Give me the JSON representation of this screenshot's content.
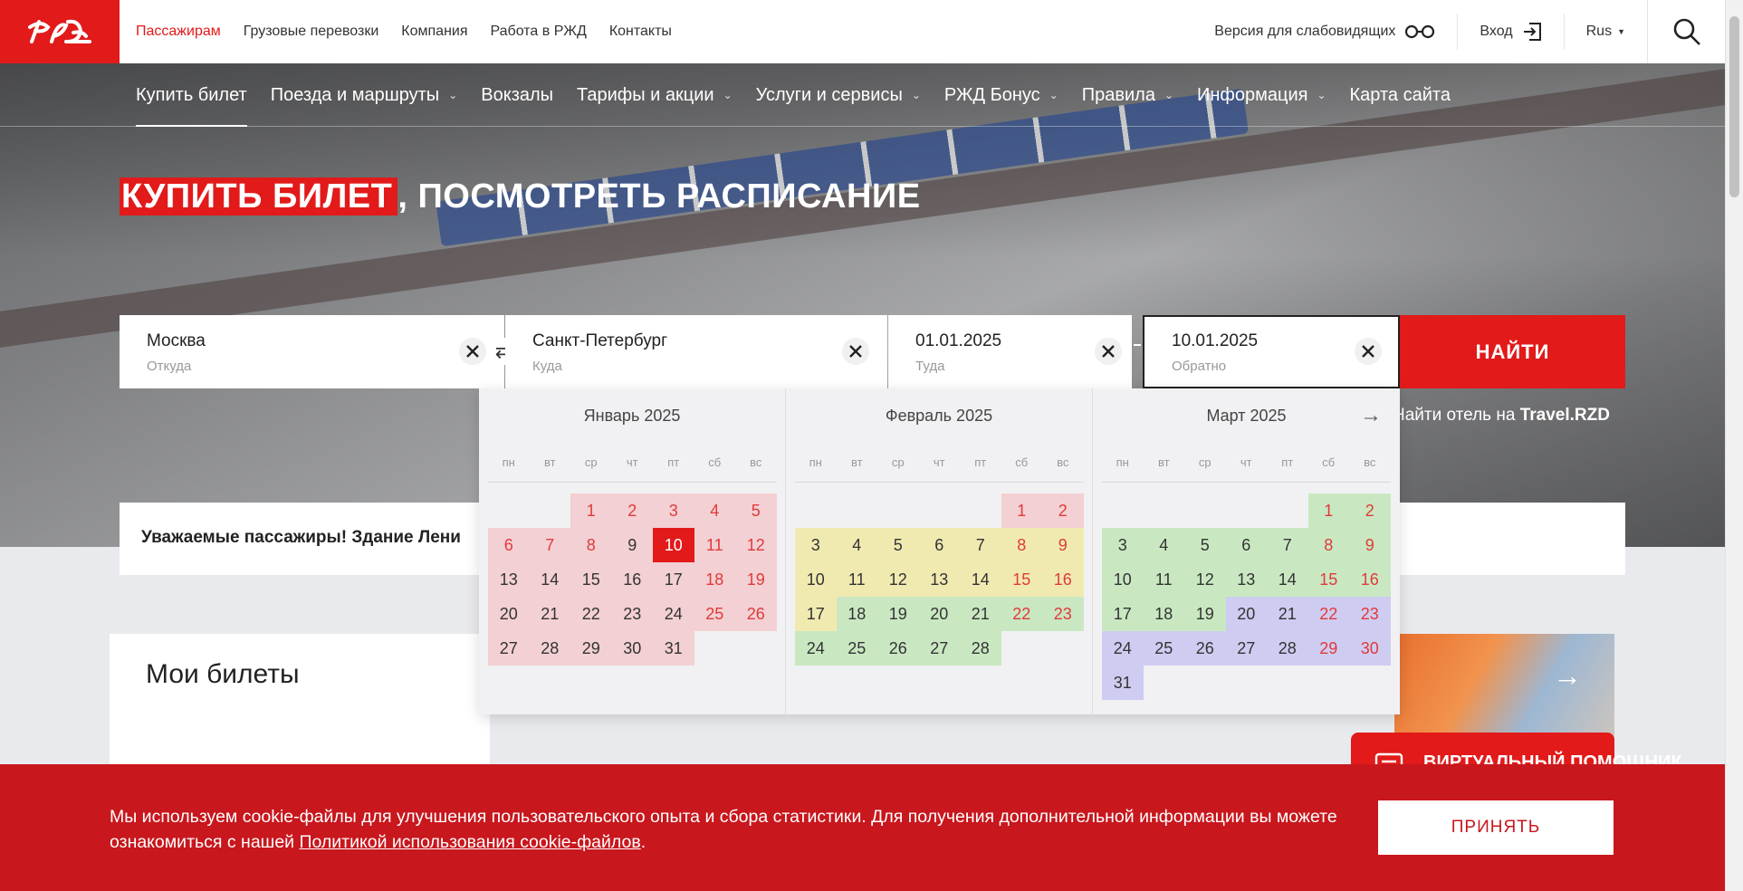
{
  "topbar": {
    "nav": [
      "Пассажирам",
      "Грузовые перевозки",
      "Компания",
      "Работа в РЖД",
      "Контакты"
    ],
    "accessibility": "Версия для слабовидящих",
    "login": "Вход",
    "lang": "Rus"
  },
  "mainnav": [
    {
      "label": "Купить билет",
      "chevron": false
    },
    {
      "label": "Поезда и маршруты",
      "chevron": true
    },
    {
      "label": "Вокзалы",
      "chevron": false
    },
    {
      "label": "Тарифы и акции",
      "chevron": true
    },
    {
      "label": "Услуги и сервисы",
      "chevron": true
    },
    {
      "label": "РЖД Бонус",
      "chevron": true
    },
    {
      "label": "Правила",
      "chevron": true
    },
    {
      "label": "Информация",
      "chevron": true
    },
    {
      "label": "Карта сайта",
      "chevron": false
    }
  ],
  "hero": {
    "title_highlight": "КУПИТЬ БИЛЕТ",
    "title_rest": ", ПОСМОТРЕТЬ РАСПИСАНИЕ"
  },
  "search": {
    "from_value": "Москва",
    "from_label": "Откуда",
    "to_value": "Санкт-Петербург",
    "to_label": "Куда",
    "date_value": "01.01.2025",
    "date_label": "Туда",
    "return_value": "10.01.2025",
    "return_label": "Обратно",
    "find_label": "НАЙТИ"
  },
  "hotel": {
    "prefix": "Найти отель на ",
    "brand": "Travel.RZD"
  },
  "notice": "Уважаемые пассажиры! Здание Лени",
  "my_tickets": "Мои билеты",
  "assistant": "ВИРТУАЛЬНЫЙ ПОМОЩНИК",
  "calendar": {
    "weekdays": [
      "пн",
      "вт",
      "ср",
      "чт",
      "пт",
      "сб",
      "вс"
    ],
    "months": [
      {
        "title": "Январь 2025",
        "offset": 2,
        "days": 31,
        "colors": {
          "pink": [
            1,
            2,
            3,
            4,
            5,
            6,
            7,
            8,
            9,
            11,
            12,
            13,
            14,
            15,
            16,
            17,
            18,
            19,
            20,
            21,
            22,
            23,
            24,
            25,
            26,
            27,
            28,
            29,
            30,
            31
          ]
        },
        "weekend": [
          1,
          2,
          3,
          4,
          5,
          6,
          7,
          8,
          11,
          12,
          18,
          19,
          25,
          26
        ],
        "selected": [
          10
        ]
      },
      {
        "title": "Февраль 2025",
        "offset": 5,
        "days": 28,
        "colors": {
          "pink": [
            1,
            2
          ],
          "yellow": [
            3,
            4,
            5,
            6,
            7,
            8,
            9,
            10,
            11,
            12,
            13,
            14,
            15,
            16,
            17
          ],
          "green": [
            18,
            19,
            20,
            21,
            22,
            23,
            24,
            25,
            26,
            27,
            28
          ]
        },
        "weekend": [
          1,
          2,
          8,
          9,
          15,
          16,
          22,
          23
        ],
        "selected": []
      },
      {
        "title": "Март 2025",
        "offset": 5,
        "days": 31,
        "colors": {
          "green": [
            1,
            2,
            3,
            4,
            5,
            6,
            7,
            8,
            9,
            10,
            11,
            12,
            13,
            14,
            15,
            16,
            17,
            18,
            19
          ],
          "purple": [
            20,
            21,
            22,
            23,
            24,
            25,
            26,
            27,
            28,
            29,
            30,
            31
          ]
        },
        "weekend": [
          1,
          2,
          8,
          9,
          15,
          16,
          22,
          23,
          29,
          30
        ],
        "selected": []
      }
    ]
  },
  "cookie": {
    "text": "Мы используем cookie-файлы для улучшения пользовательского опыта и сбора статистики. Для получения дополнительной информации вы можете ознакомиться с нашей ",
    "link": "Политикой использования cookie-файлов",
    "end": ".",
    "accept": "ПРИНЯТЬ"
  }
}
